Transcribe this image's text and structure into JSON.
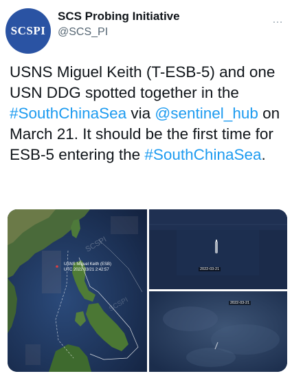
{
  "account": {
    "avatar_text": "SCSPI",
    "display_name": "SCS Probing Initiative",
    "handle": "@SCS_PI"
  },
  "menu": {
    "more_icon": "…"
  },
  "tweet": {
    "segments": [
      {
        "text": "USNS Miguel Keith (T-ESB-5) and one USN DDG spotted together in the ",
        "link": false
      },
      {
        "text": "#SouthChinaSea",
        "link": true
      },
      {
        "text": " via ",
        "link": false
      },
      {
        "text": "@sentinel_hub",
        "link": true
      },
      {
        "text": " on March 21. It should be the first time for ESB-5 entering the ",
        "link": false
      },
      {
        "text": "#SouthChinaSea",
        "link": true
      },
      {
        "text": ".",
        "link": false
      }
    ]
  },
  "media": {
    "map": {
      "label_line1": "USNS Miguel Keith (ESB)",
      "label_line2": "UTC 2022 03/21 2:42:57",
      "watermark": "SCSPI"
    },
    "sat1": {
      "date": "2022-03-21"
    },
    "sat2": {
      "date": "2022-03-21"
    }
  },
  "colors": {
    "link": "#1d9bf0",
    "avatar_bg": "#2a53a3",
    "text": "#0f1419",
    "secondary": "#536471"
  }
}
